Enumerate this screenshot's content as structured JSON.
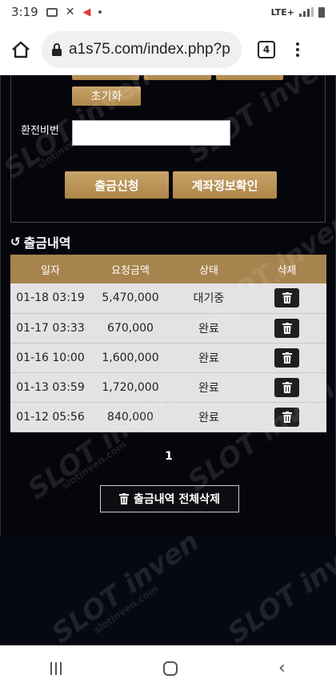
{
  "status_bar": {
    "time": "3:19",
    "network": "LTE+"
  },
  "browser": {
    "url": "a1s75.com/index.php?p",
    "tab_count": "4"
  },
  "form": {
    "reset_label": "초기화",
    "password_label": "환전비번",
    "password_value": "",
    "withdraw_button": "출금신청",
    "account_button": "계좌정보확인"
  },
  "history": {
    "title": "출금내역",
    "headers": {
      "date": "일자",
      "amount": "요청금액",
      "status": "상태",
      "delete": "삭제"
    },
    "rows": [
      {
        "date": "01-18 03:19",
        "amount": "5,470,000",
        "status": "대기중"
      },
      {
        "date": "01-17 03:33",
        "amount": "670,000",
        "status": "완료"
      },
      {
        "date": "01-16 10:00",
        "amount": "1,600,000",
        "status": "완료"
      },
      {
        "date": "01-13 03:59",
        "amount": "1,720,000",
        "status": "완료"
      },
      {
        "date": "01-12 05:56",
        "amount": "840,000",
        "status": "완료"
      }
    ],
    "page": "1",
    "delete_all_label": "출금내역 전체삭제"
  },
  "watermark": {
    "big": "SLOT inven",
    "small": "slotinven.com"
  },
  "colors": {
    "gold": "#b08a4f",
    "table_header": "#a7834d",
    "row_bg": "#e3e3e3"
  }
}
